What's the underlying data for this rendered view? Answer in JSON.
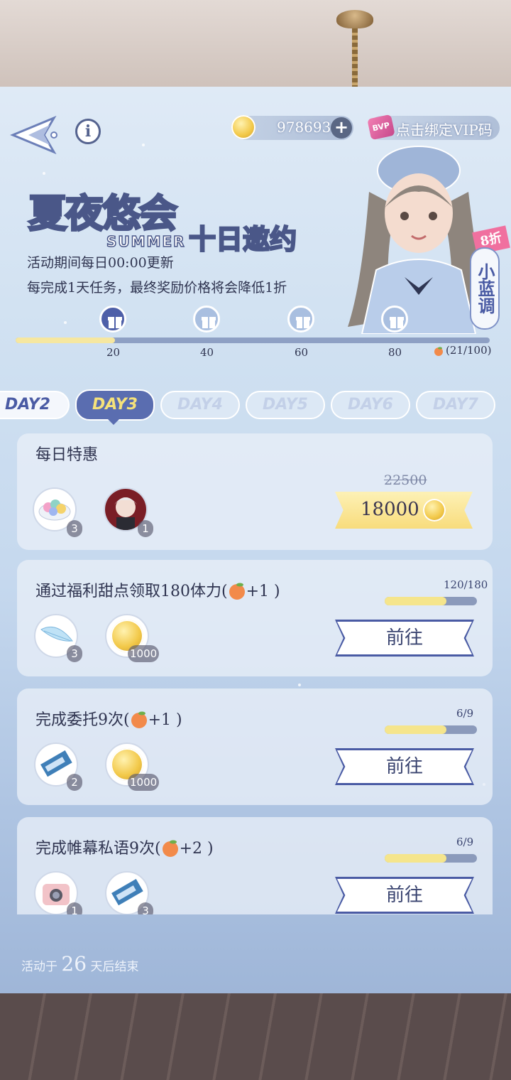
{
  "header": {
    "coins": "978693",
    "vip_tag": "BVP",
    "vip_text": "点击绑定VIP码"
  },
  "banner": {
    "title_main": "夏夜悠会",
    "title_summer": "SUMMER",
    "title_sub": "十日邀约",
    "desc_line1": "活动期间每日00:00更新",
    "desc_line2": "每完成1天任务，最终奖励价格将会降低1折",
    "discount_tag": "8折",
    "character_name": "小蓝调"
  },
  "milestones": {
    "labels": [
      "20",
      "40",
      "60",
      "80"
    ],
    "progress_text": "(21/100)",
    "progress_fraction": 0.21
  },
  "tabs": [
    "DAY2",
    "DAY3",
    "DAY4",
    "DAY5",
    "DAY6",
    "DAY7"
  ],
  "active_tab": "DAY3",
  "daily_deal": {
    "title": "每日特惠",
    "items": [
      {
        "icon": "macaron-plate-icon",
        "count": "3"
      },
      {
        "icon": "character-portrait-icon",
        "count": "1"
      }
    ],
    "old_price": "22500",
    "price": "18000"
  },
  "tasks": [
    {
      "title": "通过福利甜点领取180体力(",
      "reward": "+1 )",
      "progress": "120/180",
      "fraction": 0.67,
      "items": [
        {
          "icon": "feather-icon",
          "count": "3"
        },
        {
          "icon": "gold-coin-icon",
          "count": "1000"
        }
      ],
      "button": "前往"
    },
    {
      "title": "完成委托9次(",
      "reward": "+1 )",
      "progress": "6/9",
      "fraction": 0.67,
      "items": [
        {
          "icon": "chocolate-bar-icon",
          "count": "2"
        },
        {
          "icon": "gold-coin-icon",
          "count": "1000"
        }
      ],
      "button": "前往"
    },
    {
      "title": "完成帷幕私语9次(",
      "reward": "+2 )",
      "progress": "6/9",
      "fraction": 0.67,
      "items": [
        {
          "icon": "instant-camera-icon",
          "count": "1"
        },
        {
          "icon": "chocolate-bar-icon",
          "count": "3"
        }
      ],
      "button": "前往"
    }
  ],
  "footer": {
    "prefix": "活动于",
    "days": "26",
    "suffix": "天后结束"
  }
}
